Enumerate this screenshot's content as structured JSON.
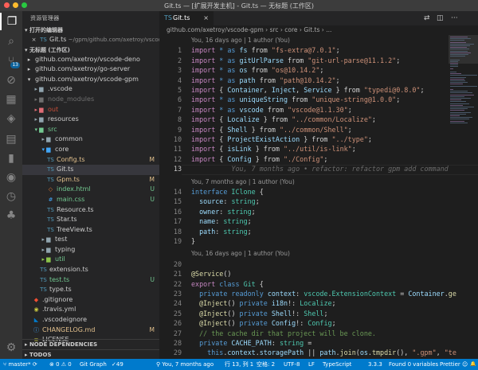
{
  "window": {
    "title": "Git.ts — [扩展开发主机] - Git.ts — 无标题 (工作区)"
  },
  "colors": {
    "accent": "#007acc",
    "sidebar": "#252526",
    "editor": "#1e1e1e",
    "activity": "#333333",
    "modified": "#e2c08d",
    "untracked": "#73c991"
  },
  "activity_bar": {
    "items": [
      {
        "name": "explorer-icon",
        "glyph": "❐"
      },
      {
        "name": "search-icon",
        "glyph": "⌕"
      },
      {
        "name": "source-control-icon",
        "glyph": "⑂",
        "badge": "13"
      },
      {
        "name": "debug-icon",
        "glyph": "⊘"
      },
      {
        "name": "extensions-icon",
        "glyph": "▦"
      },
      {
        "name": "layers-icon",
        "glyph": "◈"
      },
      {
        "name": "docker-icon",
        "glyph": "▤"
      },
      {
        "name": "bookmark-icon",
        "glyph": "▮"
      },
      {
        "name": "git-graph-icon",
        "glyph": "◉"
      },
      {
        "name": "history-icon",
        "glyph": "◷"
      },
      {
        "name": "tree-icon",
        "glyph": "♣"
      },
      {
        "name": "settings-gear-icon",
        "glyph": "⚙"
      }
    ]
  },
  "sidebar": {
    "title": "资源管理器",
    "open_editors_header": "打开的编辑器",
    "open_editors": [
      {
        "label": "Git.ts",
        "path": "~/gpm/github.com/axetroy/vscode-..."
      }
    ],
    "workspace_header": "无标题 (工作区)",
    "tree": [
      {
        "label": "github.com/axetroy/vscode-deno",
        "depth": 1,
        "kind": "root",
        "status": ""
      },
      {
        "label": "github.com/axetroy/go-server",
        "depth": 1,
        "kind": "root",
        "status": ""
      },
      {
        "label": "github.com/axetroy/vscode-gpm",
        "depth": 1,
        "kind": "root-open",
        "status": ""
      },
      {
        "label": ".vscode",
        "depth": 2,
        "kind": "folder",
        "status": ""
      },
      {
        "label": "node_modules",
        "depth": 2,
        "kind": "folder-dim",
        "status": ""
      },
      {
        "label": "out",
        "depth": 2,
        "kind": "folder-red",
        "status": ""
      },
      {
        "label": "resources",
        "depth": 2,
        "kind": "folder",
        "status": ""
      },
      {
        "label": "src",
        "depth": 2,
        "kind": "folder-open-green",
        "status": ""
      },
      {
        "label": "common",
        "depth": 3,
        "kind": "folder",
        "status": ""
      },
      {
        "label": "core",
        "depth": 3,
        "kind": "folder-open",
        "status": ""
      },
      {
        "label": "Config.ts",
        "depth": 4,
        "kind": "ts",
        "status": "M"
      },
      {
        "label": "Git.ts",
        "depth": 4,
        "kind": "ts-sel",
        "status": ""
      },
      {
        "label": "Gpm.ts",
        "depth": 4,
        "kind": "ts",
        "status": "M"
      },
      {
        "label": "index.html",
        "depth": 4,
        "kind": "html",
        "status": "U"
      },
      {
        "label": "main.css",
        "depth": 4,
        "kind": "css",
        "status": "U"
      },
      {
        "label": "Resource.ts",
        "depth": 4,
        "kind": "ts",
        "status": ""
      },
      {
        "label": "Star.ts",
        "depth": 4,
        "kind": "ts",
        "status": ""
      },
      {
        "label": "TreeView.ts",
        "depth": 4,
        "kind": "ts",
        "status": ""
      },
      {
        "label": "test",
        "depth": 3,
        "kind": "folder",
        "status": ""
      },
      {
        "label": "typing",
        "depth": 3,
        "kind": "folder",
        "status": ""
      },
      {
        "label": "util",
        "depth": 3,
        "kind": "folder-green",
        "status": ""
      },
      {
        "label": "extension.ts",
        "depth": 3,
        "kind": "ts",
        "status": ""
      },
      {
        "label": "test.ts",
        "depth": 3,
        "kind": "ts-green",
        "status": "U"
      },
      {
        "label": "type.ts",
        "depth": 3,
        "kind": "ts",
        "status": ""
      },
      {
        "label": ".gitignore",
        "depth": 2,
        "kind": "git",
        "status": ""
      },
      {
        "label": ".travis.yml",
        "depth": 2,
        "kind": "yml",
        "status": ""
      },
      {
        "label": ".vscodeignore",
        "depth": 2,
        "kind": "vscode",
        "status": ""
      },
      {
        "label": "CHANGELOG.md",
        "depth": 2,
        "kind": "md",
        "status": "M"
      },
      {
        "label": "LICENSE",
        "depth": 2,
        "kind": "file",
        "status": ""
      }
    ],
    "bottom_sections": [
      "NODE DEPENDENCIES",
      "TODOS"
    ]
  },
  "tabs": [
    {
      "label": "Git.ts"
    }
  ],
  "tab_actions": [
    {
      "name": "open-changes-icon",
      "glyph": "⇄"
    },
    {
      "name": "split-editor-icon",
      "glyph": "◫"
    },
    {
      "name": "more-actions-icon",
      "glyph": "···"
    }
  ],
  "breadcrumb": [
    "github.com/axetroy/vscode-gpm",
    "src",
    "core",
    "Git.ts",
    "..."
  ],
  "editor": {
    "lenses": [
      {
        "before_line": 1,
        "text": "You, 16 days ago | 1 author (You)"
      },
      {
        "before_line": 14,
        "text": "You, 7 months ago | 1 author (You)"
      },
      {
        "before_line": 20,
        "text": "You, 16 days ago | 1 author (You)"
      }
    ],
    "current_line": 13,
    "ghost_text": "You, 7 months ago • refactor: refactor gpm add command",
    "lines": [
      [
        [
          "import ",
          "kc"
        ],
        [
          "* as ",
          "k"
        ],
        [
          "fs",
          "v"
        ],
        [
          " from ",
          ""
        ],
        [
          "\"fs-extra@7.0.1\"",
          "s"
        ],
        [
          ";",
          ""
        ]
      ],
      [
        [
          "import ",
          "kc"
        ],
        [
          "* as ",
          "k"
        ],
        [
          "gitUrlParse",
          "v"
        ],
        [
          " from ",
          ""
        ],
        [
          "\"git-url-parse@11.1.2\"",
          "s"
        ],
        [
          ";",
          ""
        ]
      ],
      [
        [
          "import ",
          "kc"
        ],
        [
          "* as ",
          "k"
        ],
        [
          "os",
          "v"
        ],
        [
          " from ",
          ""
        ],
        [
          "\"os@10.14.2\"",
          "s"
        ],
        [
          ";",
          ""
        ]
      ],
      [
        [
          "import ",
          "kc"
        ],
        [
          "* as ",
          "k"
        ],
        [
          "path",
          "v"
        ],
        [
          " from ",
          ""
        ],
        [
          "\"path@10.14.2\"",
          "s"
        ],
        [
          ";",
          ""
        ]
      ],
      [
        [
          "import ",
          "kc"
        ],
        [
          "{ ",
          ""
        ],
        [
          "Container",
          "v"
        ],
        [
          ", ",
          ""
        ],
        [
          "Inject",
          "v"
        ],
        [
          ", ",
          ""
        ],
        [
          "Service",
          "v"
        ],
        [
          " } from ",
          ""
        ],
        [
          "\"typedi@0.8.0\"",
          "s"
        ],
        [
          ";",
          ""
        ]
      ],
      [
        [
          "import ",
          "kc"
        ],
        [
          "* as ",
          "k"
        ],
        [
          "uniqueString",
          "v"
        ],
        [
          " from ",
          ""
        ],
        [
          "\"unique-string@1.0.0\"",
          "s"
        ],
        [
          ";",
          ""
        ]
      ],
      [
        [
          "import ",
          "kc"
        ],
        [
          "* as ",
          "k"
        ],
        [
          "vscode",
          "v"
        ],
        [
          " from ",
          ""
        ],
        [
          "\"vscode@1.1.30\"",
          "s"
        ],
        [
          ";",
          ""
        ]
      ],
      [
        [
          "import ",
          "kc"
        ],
        [
          "{ ",
          ""
        ],
        [
          "Localize",
          "v"
        ],
        [
          " } from ",
          ""
        ],
        [
          "\"../common/Localize\"",
          "s"
        ],
        [
          ";",
          ""
        ]
      ],
      [
        [
          "import ",
          "kc"
        ],
        [
          "{ ",
          ""
        ],
        [
          "Shell",
          "v"
        ],
        [
          " } from ",
          ""
        ],
        [
          "\"../common/Shell\"",
          "s"
        ],
        [
          ";",
          ""
        ]
      ],
      [
        [
          "import ",
          "kc"
        ],
        [
          "{ ",
          ""
        ],
        [
          "ProjectExistAction",
          "v"
        ],
        [
          " } from ",
          ""
        ],
        [
          "\"../type\"",
          "s"
        ],
        [
          ";",
          ""
        ]
      ],
      [
        [
          "import ",
          "kc"
        ],
        [
          "{ ",
          ""
        ],
        [
          "isLink",
          "v"
        ],
        [
          " } from ",
          ""
        ],
        [
          "\"../util/is-link\"",
          "s"
        ],
        [
          ";",
          ""
        ]
      ],
      [
        [
          "import ",
          "kc"
        ],
        [
          "{ ",
          ""
        ],
        [
          "Config",
          "v"
        ],
        [
          " } from ",
          ""
        ],
        [
          "\"./Config\"",
          "s"
        ],
        [
          ";",
          ""
        ]
      ],
      [],
      [
        [
          "interface ",
          "k"
        ],
        [
          "IClone",
          "t"
        ],
        [
          " {",
          ""
        ]
      ],
      [
        [
          "  source",
          "v"
        ],
        [
          ": ",
          ""
        ],
        [
          "string",
          "t"
        ],
        [
          ";",
          ""
        ]
      ],
      [
        [
          "  owner",
          "v"
        ],
        [
          ": ",
          ""
        ],
        [
          "string",
          "t"
        ],
        [
          ";",
          ""
        ]
      ],
      [
        [
          "  name",
          "v"
        ],
        [
          ": ",
          ""
        ],
        [
          "string",
          "t"
        ],
        [
          ";",
          ""
        ]
      ],
      [
        [
          "  path",
          "v"
        ],
        [
          ": ",
          ""
        ],
        [
          "string",
          "t"
        ],
        [
          ";",
          ""
        ]
      ],
      [
        [
          "}",
          ""
        ]
      ],
      [],
      [
        [
          "@",
          "dec"
        ],
        [
          "Service",
          "f"
        ],
        [
          "()",
          ""
        ]
      ],
      [
        [
          "export ",
          "kc"
        ],
        [
          "class ",
          "k"
        ],
        [
          "Git",
          "t"
        ],
        [
          " {",
          ""
        ]
      ],
      [
        [
          "  private ",
          "k"
        ],
        [
          "readonly ",
          "k"
        ],
        [
          "context",
          "v"
        ],
        [
          ": ",
          ""
        ],
        [
          "vscode",
          "t"
        ],
        [
          ".",
          ""
        ],
        [
          "ExtensionContext",
          "t"
        ],
        [
          " = ",
          ""
        ],
        [
          "Container",
          "v"
        ],
        [
          ".",
          ""
        ],
        [
          "ge",
          "f"
        ]
      ],
      [
        [
          "  @",
          "dec"
        ],
        [
          "Inject",
          "f"
        ],
        [
          "() ",
          ""
        ],
        [
          "private ",
          "k"
        ],
        [
          "i18n",
          "v"
        ],
        [
          "!: ",
          ""
        ],
        [
          "Localize",
          "t"
        ],
        [
          ";",
          ""
        ]
      ],
      [
        [
          "  @",
          "dec"
        ],
        [
          "Inject",
          "f"
        ],
        [
          "() ",
          ""
        ],
        [
          "private ",
          "k"
        ],
        [
          "Shell",
          "v"
        ],
        [
          "!: ",
          ""
        ],
        [
          "Shell",
          "t"
        ],
        [
          ";",
          ""
        ]
      ],
      [
        [
          "  @",
          "dec"
        ],
        [
          "Inject",
          "f"
        ],
        [
          "() ",
          ""
        ],
        [
          "private ",
          "k"
        ],
        [
          "Config",
          "v"
        ],
        [
          "!: ",
          ""
        ],
        [
          "Config",
          "t"
        ],
        [
          ";",
          ""
        ]
      ],
      [
        [
          "  // the cache dir that project will be clone.",
          "c"
        ]
      ],
      [
        [
          "  private ",
          "k"
        ],
        [
          "CACHE_PATH",
          "v"
        ],
        [
          ": ",
          ""
        ],
        [
          "string",
          "t"
        ],
        [
          " =",
          ""
        ]
      ],
      [
        [
          "    this",
          "k"
        ],
        [
          ".",
          ""
        ],
        [
          "context",
          "v"
        ],
        [
          ".",
          ""
        ],
        [
          "storagePath",
          "v"
        ],
        [
          " || ",
          ""
        ],
        [
          "path",
          "v"
        ],
        [
          ".",
          ""
        ],
        [
          "join",
          "f"
        ],
        [
          "(",
          ""
        ],
        [
          "os",
          "v"
        ],
        [
          ".",
          ""
        ],
        [
          "tmpdir",
          "f"
        ],
        [
          "(), ",
          ""
        ],
        [
          "\".gpm\"",
          "s"
        ],
        [
          ", ",
          ""
        ],
        [
          "\"te",
          "s"
        ]
      ],
      [],
      [
        [
          "  /**",
          "c"
        ]
      ]
    ]
  },
  "statusbar": {
    "branch": "master*",
    "sync": "⟳",
    "errors": "0",
    "warnings": "0",
    "git_graph": "Git Graph",
    "git_count": "49",
    "blame": "You, 7 months ago",
    "position": "行 13, 列 1",
    "spaces": "空格: 2",
    "encoding": "UTF-8",
    "eol": "LF",
    "language": "TypeScript",
    "version": "3.3.3",
    "variables": "Found 0 variables",
    "formatter": "Prettier",
    "feedback": "☺",
    "bell": "🔔"
  }
}
